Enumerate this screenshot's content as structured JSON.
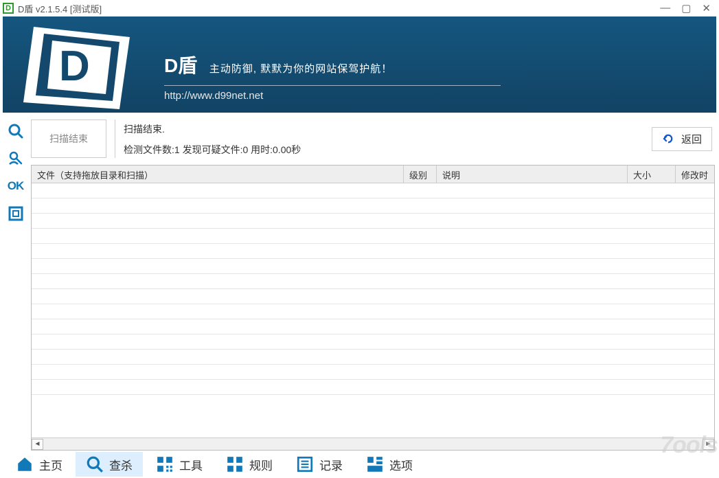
{
  "titlebar": {
    "icon_letter": "D",
    "title": "D盾 v2.1.5.4 [测试版]"
  },
  "banner": {
    "title": "D盾",
    "subtitle": "主动防御, 默默为你的网站保驾护航！",
    "url": "http://www.d99net.net"
  },
  "side": {
    "items": [
      "search",
      "inspect",
      "ok",
      "square"
    ],
    "ok_label": "OK"
  },
  "status": {
    "scan_button": "扫描结束",
    "line1": "扫描结束.",
    "line2": "检测文件数:1 发现可疑文件:0 用时:0.00秒",
    "back_label": "返回"
  },
  "table": {
    "columns": {
      "file": "文件（支持拖放目录和扫描）",
      "level": "级别",
      "desc": "说明",
      "size": "大小",
      "date": "修改时"
    },
    "rows": []
  },
  "nav": {
    "items": [
      {
        "key": "home",
        "label": "主页",
        "active": false
      },
      {
        "key": "scan",
        "label": "查杀",
        "active": true
      },
      {
        "key": "tools",
        "label": "工具",
        "active": false
      },
      {
        "key": "rules",
        "label": "规则",
        "active": false
      },
      {
        "key": "log",
        "label": "记录",
        "active": false
      },
      {
        "key": "options",
        "label": "选项",
        "active": false
      }
    ]
  },
  "watermark": "7ools",
  "colors": {
    "accent": "#1279b8",
    "banner": "#14496d"
  }
}
